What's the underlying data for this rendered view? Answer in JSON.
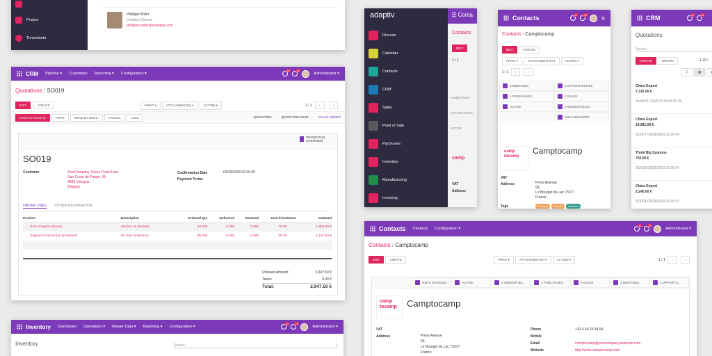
{
  "w1": {
    "nav": [
      "Project",
      "Timesheets"
    ],
    "contact_name": "Phillippe Miller",
    "contact_title": "Creative Director",
    "contact_email": "phillippe.miller@example.com"
  },
  "crm": {
    "app": "CRM",
    "menu": [
      "Pipeline ▾",
      "Customers",
      "Reporting ▾",
      "Configuration ▾"
    ],
    "badge1": "10",
    "badge2": "28",
    "user": "Administrator ▾",
    "bc_link": "Quotations",
    "bc_sep": "/",
    "bc_current": "SO019",
    "edit": "EDIT",
    "create": "CREATE",
    "print": "PRINT ▾",
    "attach": "ATTACHMENT(S) ▾",
    "action": "ACTION ▾",
    "pager": "1 / 1",
    "actions": [
      "CREATE INVOICE",
      "PRINT",
      "SEND BY EMAIL",
      "CANCEL",
      "LOCK"
    ],
    "states": [
      "QUOTATION",
      "QUOTATION SENT",
      "SALES ORDER"
    ],
    "smart": "PROJECT(S) OVERVIEW",
    "title": "SO019",
    "customer_label": "Customer",
    "customer_lines": [
      "YourCompany, Demo Portal User",
      "Rue Cesar de Paepe, 43",
      "4683 Vivegnis",
      "Belgium"
    ],
    "conf_label": "Confirmation Date",
    "conf_value": "03/29/2018 00:26:40",
    "terms_label": "Payment Terms",
    "tab1": "ORDER LINES",
    "tab2": "OTHER INFORMATION",
    "headers": [
      "Product",
      "Description",
      "Ordered Qty",
      "Delivered",
      "Invoiced",
      "Unit Price",
      "Taxes",
      "Subtotal"
    ],
    "rows": [
      [
        "GAP Analysis Service",
        "Service on demand",
        "24.000",
        "0.000",
        "0.000",
        "75.00",
        "",
        "1,800.00 €"
      ],
      [
        "Support Contract (on timesheet)",
        "On Site Assistance",
        "30.000",
        "0.000",
        "0.000",
        "38.25",
        "",
        "1,147.50 €"
      ]
    ],
    "untaxed_label": "Untaxed Amount:",
    "untaxed": "2,947.50 €",
    "taxes_label": "Taxes:",
    "taxes": "0.00 €",
    "total_label": "Total:",
    "total": "2,947.50 €"
  },
  "inventory": {
    "app": "Inventory",
    "menu": [
      "Dashboard",
      "Operations ▾",
      "Master Data ▾",
      "Reporting ▾",
      "Configuration ▾"
    ],
    "badge1": "10",
    "badge2": "29",
    "user": "Administrator ▾",
    "heading": "Inventory",
    "search": "Search..."
  },
  "adaptiv": {
    "logo": "adaptiv",
    "items": [
      {
        "label": "Discuss",
        "color": "#e0245e"
      },
      {
        "label": "Calendar",
        "color": "#d8d23a"
      },
      {
        "label": "Contacts",
        "color": "#1fa39a"
      },
      {
        "label": "CRM",
        "color": "#1f7ab4"
      },
      {
        "label": "Sales",
        "color": "#e0245e"
      },
      {
        "label": "Point of Sale",
        "color": "#5a5a5a"
      },
      {
        "label": "Purchases",
        "color": "#e0245e"
      },
      {
        "label": "Inventory",
        "color": "#e0245e"
      },
      {
        "label": "Manufacturing",
        "color": "#1f8c4c"
      },
      {
        "label": "Invoicing",
        "color": "#e0245e"
      }
    ],
    "peek_title": "Conta",
    "peek_bc": "Contacts",
    "peek_btn": "EDIT",
    "peek_pager": "1 / 1",
    "peek_stats": [
      "0 MEETINGS",
      "0 PURCHASES",
      "ACTIVE"
    ],
    "peek_labels": [
      "VAT",
      "Address",
      "Tags"
    ]
  },
  "contacts_mobile": {
    "app": "Contacts",
    "badge1": "11",
    "badge2": "28",
    "bc_link": "Contacts",
    "bc_current": "Camptocamp",
    "edit": "EDIT",
    "create": "CREATE",
    "print": "PRINT ▾",
    "attach": "ATTACHMENT(S) ▾",
    "action": "ACTION ▾",
    "pager": "1 / 1",
    "stats": [
      "0 MEETINGS",
      "2 OPPORTUNITIES",
      "1 PURCHASES",
      "0 SALES",
      "ACTIVE",
      "0 VENDOR BILLS",
      "0.00 € INVOICED"
    ],
    "company": "Camptocamp",
    "vat": "VAT",
    "address_label": "Address",
    "address": [
      "Press Avenue",
      "93,",
      "Le Bourget du Lac  73377",
      "France"
    ],
    "tags_label": "Tags",
    "tags": [
      "Services",
      "Vendor",
      "Services"
    ]
  },
  "crm_mobile": {
    "app": "CRM",
    "badge1": "10",
    "badge2": "28",
    "heading": "Quotations",
    "search": "Search...",
    "create": "CREATE",
    "import": "IMPORT",
    "pager": "1-20 /",
    "items": [
      {
        "name": "China Export",
        "amount": "7,315.00 €",
        "ref": "Test/001 03/29/2018 00:26:35"
      },
      {
        "name": "China Export",
        "amount": "14,981.00 €",
        "ref": "SO007 03/29/2018 00:26:34"
      },
      {
        "name": "Think Big Systems",
        "amount": "750.00 €",
        "ref": "SO008 03/29/2018 00:26:34"
      },
      {
        "name": "China Export",
        "amount": "2,240.00 €",
        "ref": "SO004 03/29/2018 00:26:33"
      }
    ]
  },
  "contacts_desktop": {
    "app": "Contacts",
    "menu": [
      "Contacts",
      "Configuration ▾"
    ],
    "badge1": "11",
    "badge2": "29",
    "user": "Administrator ▾",
    "bc_link": "Contacts",
    "bc_current": "Camptocamp",
    "edit": "EDIT",
    "create": "CREATE",
    "print": "PRINT ▾",
    "attach": "ATTACHMENT(S) ▾",
    "action": "ACTION ▾",
    "pager": "1 / 1",
    "stats": [
      "0.00 € INVOICED",
      "ACTIVE",
      "0 VENDOR BIL...",
      "1 PURCHASES",
      "0 SALES",
      "2 MEETINGS",
      "2 OPPORTU..."
    ],
    "company": "Camptocamp",
    "logo_line1": "camp",
    "logo_line2": "tocamp",
    "vat": "VAT",
    "address_label": "Address",
    "address": [
      "Press Avenue",
      "93,",
      "Le Bourget du Lac  73377",
      "France"
    ],
    "phone_label": "Phone",
    "phone": "+33 4 49 23 44 54",
    "mobile_label": "Mobile",
    "email_label": "Email",
    "email": "camptocamp@yourcompany.example.com",
    "website_label": "Website",
    "website": "http://www.camptocamp.com"
  }
}
